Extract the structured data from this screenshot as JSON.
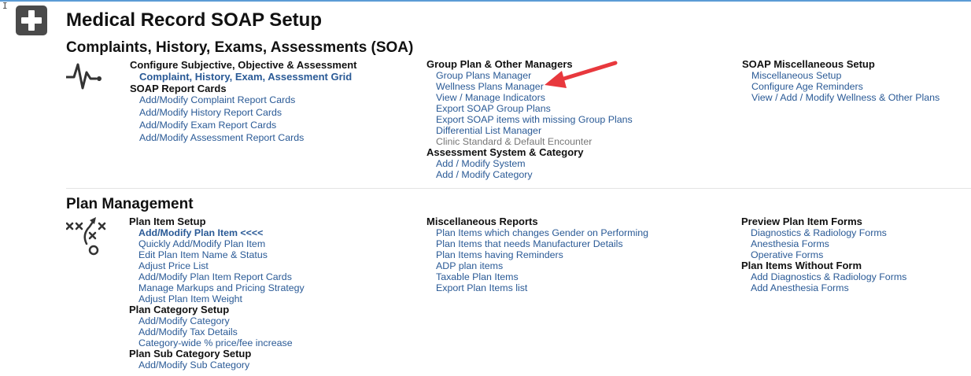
{
  "page": {
    "title": "Medical Record SOAP Setup",
    "cursor_glyph": "I"
  },
  "soa": {
    "heading": "Complaints, History, Exams, Assessments (SOA)",
    "icon": "vital-signs-icon",
    "col1": {
      "groups": [
        {
          "heading": "Configure Subjective, Objective & Assessment",
          "items": [
            "Complaint, History, Exam, Assessment Grid"
          ]
        },
        {
          "heading": "SOAP Report Cards",
          "items": [
            "Add/Modify Complaint Report Cards",
            "Add/Modify History Report Cards",
            "Add/Modify Exam Report Cards",
            "Add/Modify Assessment Report Cards"
          ]
        }
      ]
    },
    "col2": {
      "groups": [
        {
          "heading": "Group Plan & Other Managers",
          "items": [
            "Group Plans Manager",
            "Wellness Plans Manager",
            "View / Manage Indicators",
            "Export SOAP Group Plans",
            "Export SOAP items with missing Group Plans",
            "Differential List Manager",
            "Clinic Standard & Default Encounter"
          ]
        },
        {
          "heading": "Assessment System & Category",
          "items": [
            "Add / Modify System",
            "Add / Modify Category"
          ]
        }
      ]
    },
    "col3": {
      "groups": [
        {
          "heading": "SOAP Miscellaneous Setup",
          "items": [
            "Miscellaneous Setup",
            "Configure Age Reminders",
            "View / Add / Modify Wellness & Other Plans"
          ]
        }
      ]
    }
  },
  "plan": {
    "heading": "Plan Management",
    "icon": "play-strategy-icon",
    "col1": {
      "groups": [
        {
          "heading": "Plan Item Setup",
          "items": [
            "Add/Modify Plan Item <<<<",
            "Quickly Add/Modify Plan Item",
            "Edit Plan Item Name & Status",
            "Adjust Price List",
            "Add/Modify Plan Item Report Cards",
            "Manage Markups and Pricing Strategy",
            "Adjust Plan Item Weight"
          ]
        },
        {
          "heading": "Plan Category Setup",
          "items": [
            "Add/Modify Category",
            "Add/Modify Tax Details",
            "Category-wide % price/fee increase"
          ]
        },
        {
          "heading": "Plan Sub Category Setup",
          "items": [
            "Add/Modify Sub Category"
          ]
        }
      ]
    },
    "col2": {
      "groups": [
        {
          "heading": "Miscellaneous Reports",
          "items": [
            "Plan Items which changes Gender on Performing",
            "Plan Items that needs Manufacturer Details",
            "Plan Items having Reminders",
            "ADP plan items",
            "Taxable Plan Items",
            "Export Plan Items list"
          ]
        }
      ]
    },
    "col3": {
      "groups": [
        {
          "heading": "Preview Plan Item Forms",
          "items": [
            "Diagnostics & Radiology Forms",
            "Anesthesia Forms",
            "Operative Forms"
          ]
        },
        {
          "heading": "Plan Items Without Form",
          "items": [
            "Add Diagnostics & Radiology Forms",
            "Add Anesthesia Forms"
          ]
        }
      ]
    }
  },
  "colors": {
    "link": "#2a5a96",
    "link_disabled": "#777777",
    "annotation_arrow": "#e8383d",
    "top_border": "#5b9bd5",
    "icon_bg": "#4a4a4a"
  },
  "annotation": {
    "icon": "red-arrow-annotation",
    "target": "Wellness Plans Manager"
  }
}
